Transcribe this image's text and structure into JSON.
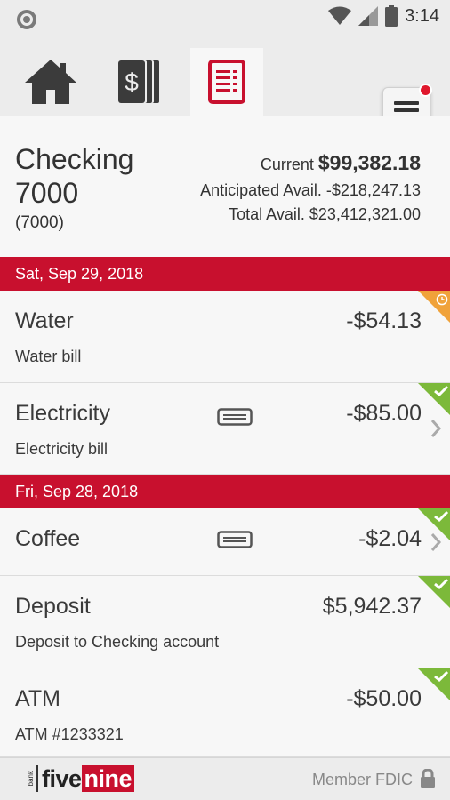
{
  "status_bar": {
    "time": "3:14"
  },
  "nav": {
    "tabs": [
      {
        "icon": "home-icon",
        "active": false
      },
      {
        "icon": "dollar-cards-icon",
        "active": false
      },
      {
        "icon": "activity-list-icon",
        "active": true
      }
    ],
    "menu_icon": "hamburger-menu-icon",
    "menu_has_notification": true
  },
  "account": {
    "name": "Checking 7000",
    "number": "(7000)",
    "current_label": "Current",
    "current_value": "$99,382.18",
    "anticipated_label": "Anticipated Avail.",
    "anticipated_value": "-$218,247.13",
    "total_label": "Total Avail.",
    "total_value": "$23,412,321.00"
  },
  "groups": [
    {
      "date": "Sat, Sep 29, 2018",
      "transactions": [
        {
          "title": "Water",
          "subtitle": "Water bill",
          "amount": "-$54.13",
          "status": "pending",
          "card": false,
          "chevron": false
        },
        {
          "title": "Electricity",
          "subtitle": "Electricity bill",
          "amount": "-$85.00",
          "status": "cleared",
          "card": true,
          "chevron": true
        }
      ]
    },
    {
      "date": "Fri, Sep 28, 2018",
      "transactions": [
        {
          "title": "Coffee",
          "subtitle": "",
          "amount": "-$2.04",
          "status": "cleared",
          "card": true,
          "chevron": true
        },
        {
          "title": "Deposit",
          "subtitle": "Deposit to Checking account",
          "amount": "$5,942.37",
          "status": "cleared",
          "card": false,
          "chevron": false
        },
        {
          "title": "ATM",
          "subtitle": "ATM #1233321",
          "amount": "-$50.00",
          "status": "cleared",
          "card": false,
          "chevron": false
        }
      ]
    }
  ],
  "footer": {
    "logo_bank": "bank",
    "logo_five": "five",
    "logo_nine": "nine",
    "fdic": "Member FDIC"
  },
  "colors": {
    "brand_red": "#c8102e",
    "cleared_green": "#7cb93a",
    "pending_orange": "#f0a23a"
  }
}
